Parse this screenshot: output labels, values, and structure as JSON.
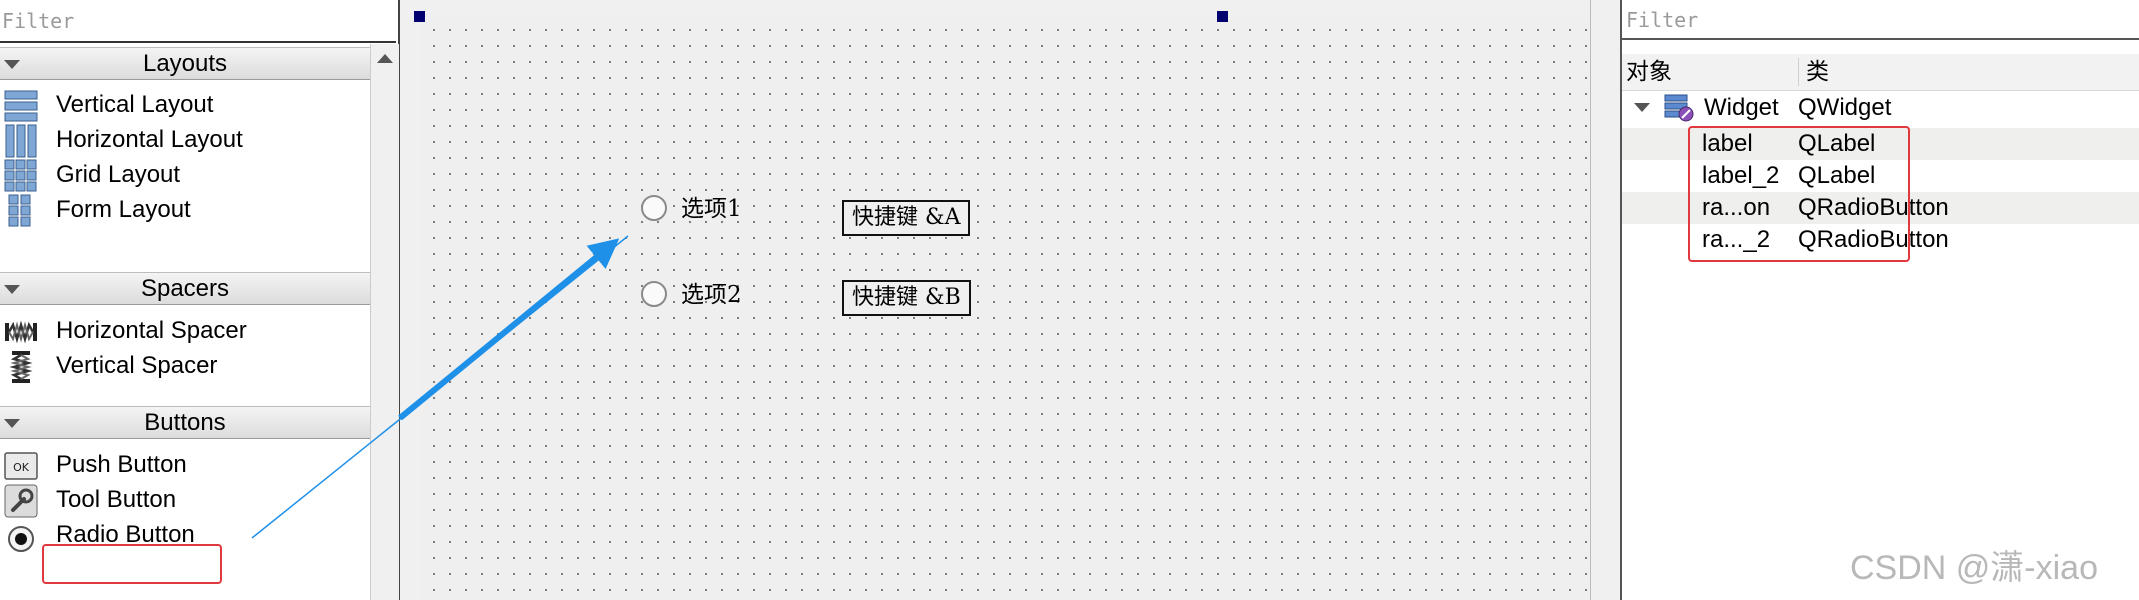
{
  "widget_box": {
    "filter_placeholder": "Filter",
    "categories": [
      {
        "label": "Layouts"
      },
      {
        "label": "Spacers"
      },
      {
        "label": "Buttons"
      }
    ],
    "items": [
      {
        "label": "Vertical Layout",
        "icon": "vertical-layout-icon"
      },
      {
        "label": "Horizontal Layout",
        "icon": "horizontal-layout-icon"
      },
      {
        "label": "Grid Layout",
        "icon": "grid-layout-icon"
      },
      {
        "label": "Form Layout",
        "icon": "form-layout-icon"
      },
      {
        "label": "Horizontal Spacer",
        "icon": "horizontal-spacer-icon"
      },
      {
        "label": "Vertical Spacer",
        "icon": "vertical-spacer-icon"
      },
      {
        "label": "Push Button",
        "icon": "push-button-icon",
        "icon_text": "OK"
      },
      {
        "label": "Tool Button",
        "icon": "tool-button-icon"
      },
      {
        "label": "Radio Button",
        "icon": "radio-button-icon"
      }
    ],
    "highlight_color": "#e0393e"
  },
  "canvas": {
    "radios": [
      {
        "label": "选项1"
      },
      {
        "label": "选项2"
      }
    ],
    "labels": [
      {
        "text": "快捷键 &A"
      },
      {
        "text": "快捷键 &B"
      }
    ],
    "arrow_color": "#1e90e8"
  },
  "object_inspector": {
    "filter_placeholder": "Filter",
    "headers": {
      "object": "对象",
      "class": "类"
    },
    "root": {
      "name": "Widget",
      "class": "QWidget",
      "icon": "widget-icon"
    },
    "children": [
      {
        "name": "label",
        "class": "QLabel"
      },
      {
        "name": "label_2",
        "class": "QLabel"
      },
      {
        "name": "ra...on",
        "class": "QRadioButton"
      },
      {
        "name": "ra..._2",
        "class": "QRadioButton"
      }
    ]
  },
  "watermark": "CSDN @潇-xiao"
}
